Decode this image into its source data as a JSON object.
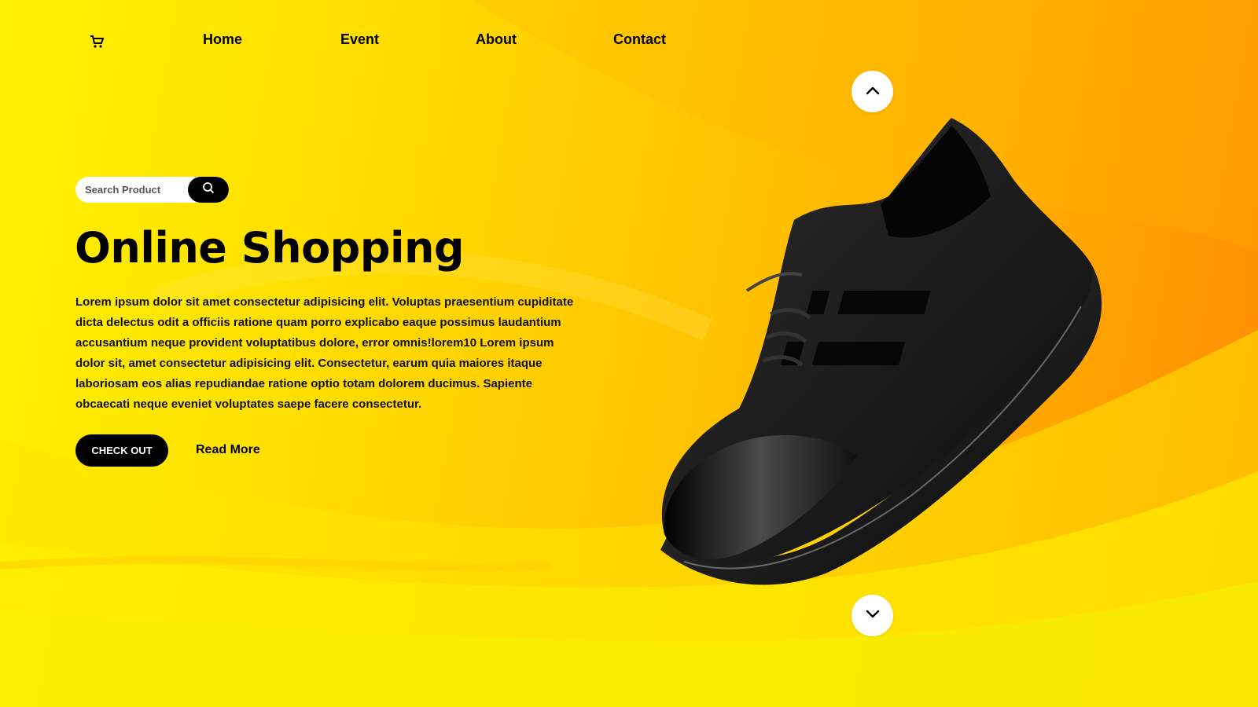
{
  "nav": {
    "cart_icon": "cart-icon",
    "links": [
      "Home",
      "Event",
      "About",
      "Contact"
    ]
  },
  "search": {
    "placeholder": "Search Product",
    "icon": "search-icon"
  },
  "hero": {
    "title": "Online Shopping",
    "text": "Lorem ipsum dolor sit amet consectetur adipisicing elit. Voluptas praesentium cupiditate dicta delectus odit a officiis ratione quam porro explicabo eaque possimus laudantium accusantium neque provident voluptatibus dolore, error omnis!lorem10 Lorem ipsum dolor sit, amet consectetur adipisicing elit. Consectetur, earum quia maiores itaque laboriosam eos alias repudiandae ratione optio totam dolorem ducimus. Sapiente obcaecati neque eveniet voluptates saepe facere consectetur.",
    "checkout_label": "CHECK OUT",
    "read_more_label": "Read More"
  },
  "carousel": {
    "up_icon": "chevron-up-icon",
    "down_icon": "chevron-down-icon"
  },
  "colors": {
    "accent": "#000000",
    "background_start": "#fff200",
    "background_end": "#ff8a00",
    "button_text": "#ffffff"
  }
}
